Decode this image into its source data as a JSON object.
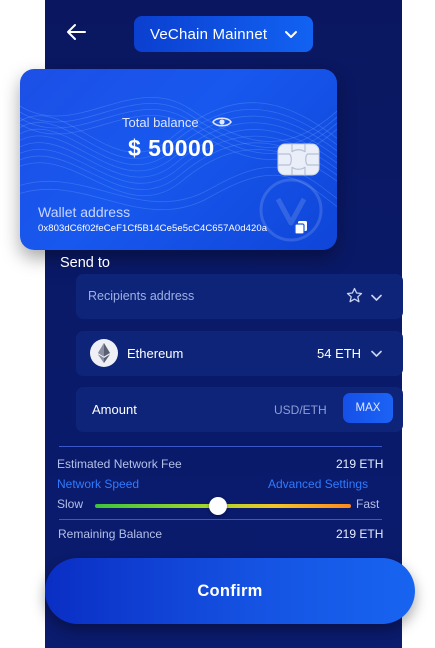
{
  "header": {
    "back_icon": "arrow-left-icon",
    "network_label": "VeChain Mainnet",
    "network_icon": "chevron-down-icon"
  },
  "card": {
    "total_balance_label": "Total balance",
    "balance_value": "$ 50000",
    "visibility_icon": "eye-icon",
    "chip_icon": "card-chip-icon",
    "watermark_icon": "vechain-logo-icon",
    "wallet_address_label": "Wallet address",
    "wallet_address_value": "0x803dC6f02feCeF1Cf5B14Ce5e5cC4C657A0d420a",
    "copy_icon": "copy-icon",
    "colors": {
      "card_start": "#1c4fe6",
      "card_end": "#0f45d8"
    }
  },
  "send": {
    "label": "Send to",
    "recipient_placeholder": "Recipients address",
    "favorite_icon": "star-icon",
    "dropdown_icon": "chevron-down-icon"
  },
  "asset": {
    "icon": "ethereum-icon",
    "name": "Ethereum",
    "balance": "54 ETH",
    "dropdown_icon": "chevron-down-icon"
  },
  "amount": {
    "label": "Amount",
    "unit": "USD/ETH",
    "max_label": "MAX"
  },
  "fees": {
    "network_fee_label": "Estimated Network Fee",
    "network_fee_value": "219 ETH",
    "network_speed_label": "Network Speed",
    "advanced_settings_label": "Advanced Settings",
    "slow_label": "Slow",
    "fast_label": "Fast",
    "speed_level": 0.48,
    "remaining_label": "Remaining Balance",
    "remaining_value": "219 ETH"
  },
  "confirm_label": "Confirm",
  "colors": {
    "background": "#0a1760",
    "field": "#0e2478",
    "accent": "#2f7bff",
    "button": "#1552e2"
  }
}
